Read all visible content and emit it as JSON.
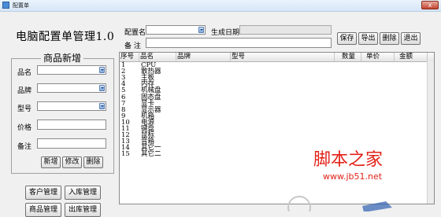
{
  "window": {
    "title": "配置单",
    "close_label": "x"
  },
  "app_title": "电脑配置单管理1.0",
  "form": {
    "group_title": "商品新增",
    "fields": {
      "name_label": "品名",
      "brand_label": "品牌",
      "model_label": "型号",
      "price_label": "价格",
      "note_label": "备注"
    },
    "buttons": {
      "add": "新增",
      "edit": "修改",
      "delete": "删除"
    }
  },
  "nav_buttons": {
    "customer": "客户管理",
    "inbound": "入库管理",
    "product": "商品管理",
    "outbound": "出库管理"
  },
  "toolbar": {
    "config_name_label": "配置名",
    "create_date_label": "生成日期",
    "note_label": "备  注",
    "save": "保存",
    "export": "导出",
    "delete": "删除",
    "exit": "退出"
  },
  "table": {
    "columns": [
      "序号",
      "品名",
      "品牌",
      "型号",
      "数量",
      "单价",
      "金额"
    ],
    "rows": [
      [
        "1",
        "CPU"
      ],
      [
        "2",
        "散热器"
      ],
      [
        "3",
        "主板"
      ],
      [
        "4",
        "内存"
      ],
      [
        "5",
        "机械盘"
      ],
      [
        "6",
        "固态盘"
      ],
      [
        "7",
        "显卡"
      ],
      [
        "8",
        "显示器"
      ],
      [
        "9",
        "机箱"
      ],
      [
        "10",
        "电源"
      ],
      [
        "11",
        "键盘"
      ],
      [
        "12",
        "鼠标"
      ],
      [
        "13",
        "音箱"
      ],
      [
        "14",
        "其它一"
      ],
      [
        "15",
        "其它二"
      ]
    ]
  },
  "watermark": {
    "text": "脚本之家",
    "url": "www.jb51.net",
    "color": "#e2231a"
  },
  "colors": {
    "titlebar": "#d6e6f7",
    "accent": "#7fa9e0"
  }
}
